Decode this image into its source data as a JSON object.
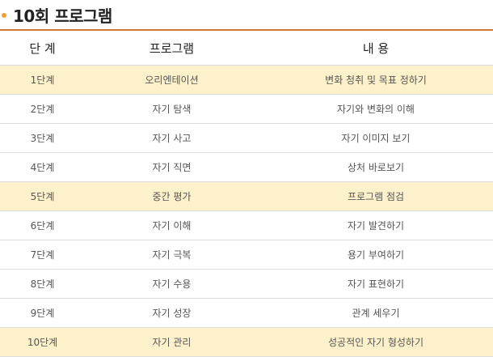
{
  "title": "10회 프로그램",
  "colors": {
    "bullet": "#f0a030",
    "header_border": "#cf7a3a",
    "highlight_row": "#fdf1cc"
  },
  "table": {
    "headers": [
      "단 계",
      "프로그램",
      "내 용"
    ],
    "rows": [
      {
        "stage": "1단계",
        "program": "오리엔테이션",
        "content": "변화 청취 및 목표 정하기",
        "highlight": true
      },
      {
        "stage": "2단계",
        "program": "자기 탐색",
        "content": "자기와 변화의 이해",
        "highlight": false
      },
      {
        "stage": "3단계",
        "program": "자기 사고",
        "content": "자기 이미지 보기",
        "highlight": false
      },
      {
        "stage": "4단계",
        "program": "자기 직면",
        "content": "상처 바로보기",
        "highlight": false
      },
      {
        "stage": "5단계",
        "program": "중간 평가",
        "content": "프로그램 점검",
        "highlight": true
      },
      {
        "stage": "6단계",
        "program": "자기 이해",
        "content": "자기 발견하기",
        "highlight": false
      },
      {
        "stage": "7단계",
        "program": "자기 극복",
        "content": "용기 부여하기",
        "highlight": false
      },
      {
        "stage": "8단계",
        "program": "자기 수용",
        "content": "자기 표현하기",
        "highlight": false
      },
      {
        "stage": "9단계",
        "program": "자기 성장",
        "content": "관계 세우기",
        "highlight": false
      },
      {
        "stage": "10단계",
        "program": "자기 관리",
        "content": "성공적인 자기 형성하기",
        "highlight": true
      }
    ]
  }
}
